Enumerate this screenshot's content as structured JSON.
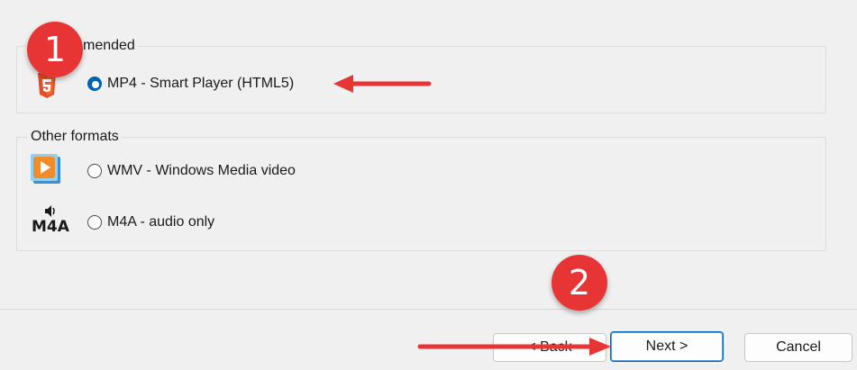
{
  "groups": {
    "recommended": {
      "title": "mended",
      "options": [
        {
          "icon": "html5-icon",
          "label": "MP4 - Smart Player (HTML5)",
          "selected": true
        }
      ]
    },
    "other": {
      "title": "Other formats",
      "options": [
        {
          "icon": "wmv-icon",
          "label": "WMV - Windows Media video",
          "selected": false
        },
        {
          "icon": "m4a-icon",
          "icon_text": "M4A",
          "label": "M4A - audio only",
          "selected": false
        }
      ]
    }
  },
  "buttons": {
    "back": "< Back",
    "next": "Next >",
    "cancel": "Cancel"
  },
  "callouts": {
    "step1": "1",
    "step2": "2"
  },
  "colors": {
    "accent": "#0063b1",
    "callout_red": "#e73535",
    "html5_orange": "#e44d26"
  }
}
